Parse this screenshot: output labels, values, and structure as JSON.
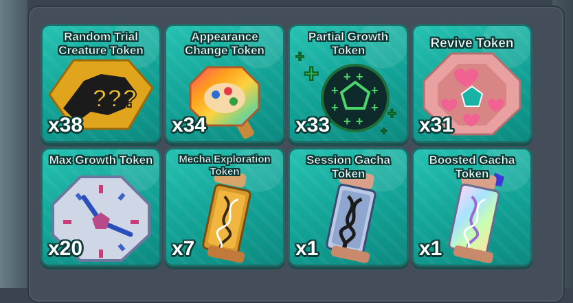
{
  "inventory": {
    "tokens": [
      {
        "name": "Random Trial Creature Token",
        "count": "x38",
        "icon": "random-trial-token-icon"
      },
      {
        "name": "Appearance Change Token",
        "count": "x34",
        "icon": "appearance-change-token-icon"
      },
      {
        "name": "Partial Growth Token",
        "count": "x33",
        "icon": "partial-growth-token-icon"
      },
      {
        "name": "Revive Token",
        "count": "x31",
        "icon": "revive-token-icon"
      },
      {
        "name": "Max Growth Token",
        "count": "x20",
        "icon": "max-growth-token-icon"
      },
      {
        "name": "Mecha Exploration Token",
        "count": "x7",
        "icon": "mecha-exploration-token-icon"
      },
      {
        "name": "Session Gacha Token",
        "count": "x1",
        "icon": "session-gacha-token-icon"
      },
      {
        "name": "Boosted Gacha Token",
        "count": "x1",
        "icon": "boosted-gacha-token-icon"
      }
    ]
  },
  "colors": {
    "card_teal": "#14a79a",
    "card_border": "#1f6b67",
    "panel": "#444e5a",
    "text_outline": "#0b3b37"
  }
}
